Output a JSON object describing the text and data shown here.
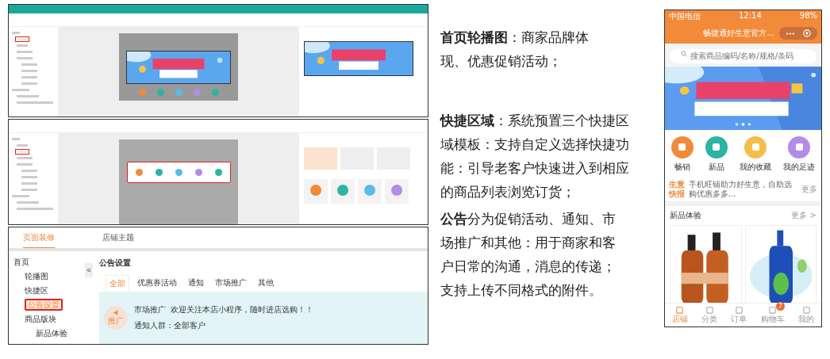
{
  "screens": [
    {
      "sidebar": [
        {
          "selected": false
        },
        {
          "selected": true
        },
        {
          "selected": false
        },
        {
          "selected": false
        },
        {
          "selected": false
        },
        {
          "selected": false
        },
        {
          "selected": false
        },
        {
          "selected": false
        },
        {
          "selected": false
        },
        {
          "selected": false
        },
        {
          "selected": false
        },
        {
          "selected": false
        }
      ],
      "preview": {
        "icons": [
          {
            "color": "#f08a3c"
          },
          {
            "color": "#2bb3a3"
          },
          {
            "color": "#5ab9e8"
          },
          {
            "color": "#b38be8"
          },
          {
            "color": "#2bb3a3"
          }
        ]
      }
    },
    {
      "sidebar": [
        {
          "selected": false
        },
        {
          "selected": false
        },
        {
          "selected": true
        },
        {
          "selected": false
        },
        {
          "selected": false
        },
        {
          "selected": false
        },
        {
          "selected": false
        },
        {
          "selected": false
        },
        {
          "selected": false
        },
        {
          "selected": false
        },
        {
          "selected": false
        },
        {
          "selected": false
        }
      ],
      "preview": {
        "shortcuts": [
          {
            "color": "#f08a3c"
          },
          {
            "color": "#2bb3a3"
          },
          {
            "color": "#5ab9e8"
          },
          {
            "color": "#b38be8"
          },
          {
            "color": "#2bb3a3"
          }
        ]
      },
      "settings": {
        "templates": [
          {
            "selected": true
          },
          {
            "selected": false
          },
          {
            "selected": false
          }
        ],
        "shortcuts": [
          {
            "color": "#f08a3c"
          },
          {
            "color": "#2bb3a3"
          },
          {
            "color": "#5ab9e8"
          },
          {
            "color": "#b38be8"
          }
        ]
      }
    },
    {
      "sub_tabs": [
        {
          "label": "页面装修",
          "selected": true
        },
        {
          "label": "店铺主题",
          "selected": false
        }
      ],
      "sidebar": [
        {
          "label": "首页",
          "selected": false,
          "children": [
            {
              "label": "轮播图",
              "selected": false
            },
            {
              "label": "快捷区",
              "selected": false
            },
            {
              "label": "公告设置",
              "selected": true
            },
            {
              "label": "商品版块",
              "selected": false,
              "children": [
                {
                  "label": "新品体验",
                  "selected": false
                }
              ]
            }
          ]
        }
      ],
      "collapse": "«",
      "notice": {
        "title": "公告设置",
        "tabs": [
          {
            "label": "全部",
            "selected": true
          },
          {
            "label": "优惠券活动",
            "selected": false
          },
          {
            "label": "通知",
            "selected": false
          },
          {
            "label": "市场推广",
            "selected": false
          },
          {
            "label": "其他",
            "selected": false
          }
        ],
        "item": {
          "badge": "推广",
          "category": "市场推广",
          "message": "欢迎关注本店小程序，随时进店选购！！",
          "audience": "通知人群：全部客户"
        }
      }
    }
  ],
  "descriptions": [
    "**首页轮播图**：商家品牌体现、优惠促销活动；",
    "**快捷区域**：系统预置三个快捷区域模板：支持自定义选择快捷功能：引导老客户快速进入到相应的商品列表浏览订货；",
    "**公告**分为促销活动、通知、市场推广和其他：用于商家和客户日常的沟通，消息的传递；支持上传不同格式的附件。"
  ],
  "phone": {
    "carrier": "中国电信",
    "time": "12:14",
    "battery": "98%",
    "title": "畅捷通好生意官方...",
    "search": {
      "placeholder": "搜索商品编码/名称/规格/条码"
    },
    "shortcuts": [
      {
        "label": "畅销",
        "color": "#f08a3c"
      },
      {
        "label": "新品",
        "color": "#2bb3a3"
      },
      {
        "label": "我的收藏",
        "color": "#f2c04a"
      },
      {
        "label": "我的足迹",
        "color": "#b38be8"
      }
    ],
    "news": {
      "badge_1": "生意",
      "badge_2": "快报",
      "text": "手机旺铺助力好生意，自助选购优惠多多...",
      "more": "更多"
    },
    "section": {
      "title": "新品体验",
      "more": "更多 >"
    },
    "tabbar": [
      {
        "label": "店铺",
        "selected": true
      },
      {
        "label": "分类",
        "selected": false
      },
      {
        "label": "订单",
        "selected": false
      },
      {
        "label": "购物车",
        "selected": false,
        "badge": "7"
      },
      {
        "label": "我的",
        "selected": false
      }
    ]
  }
}
